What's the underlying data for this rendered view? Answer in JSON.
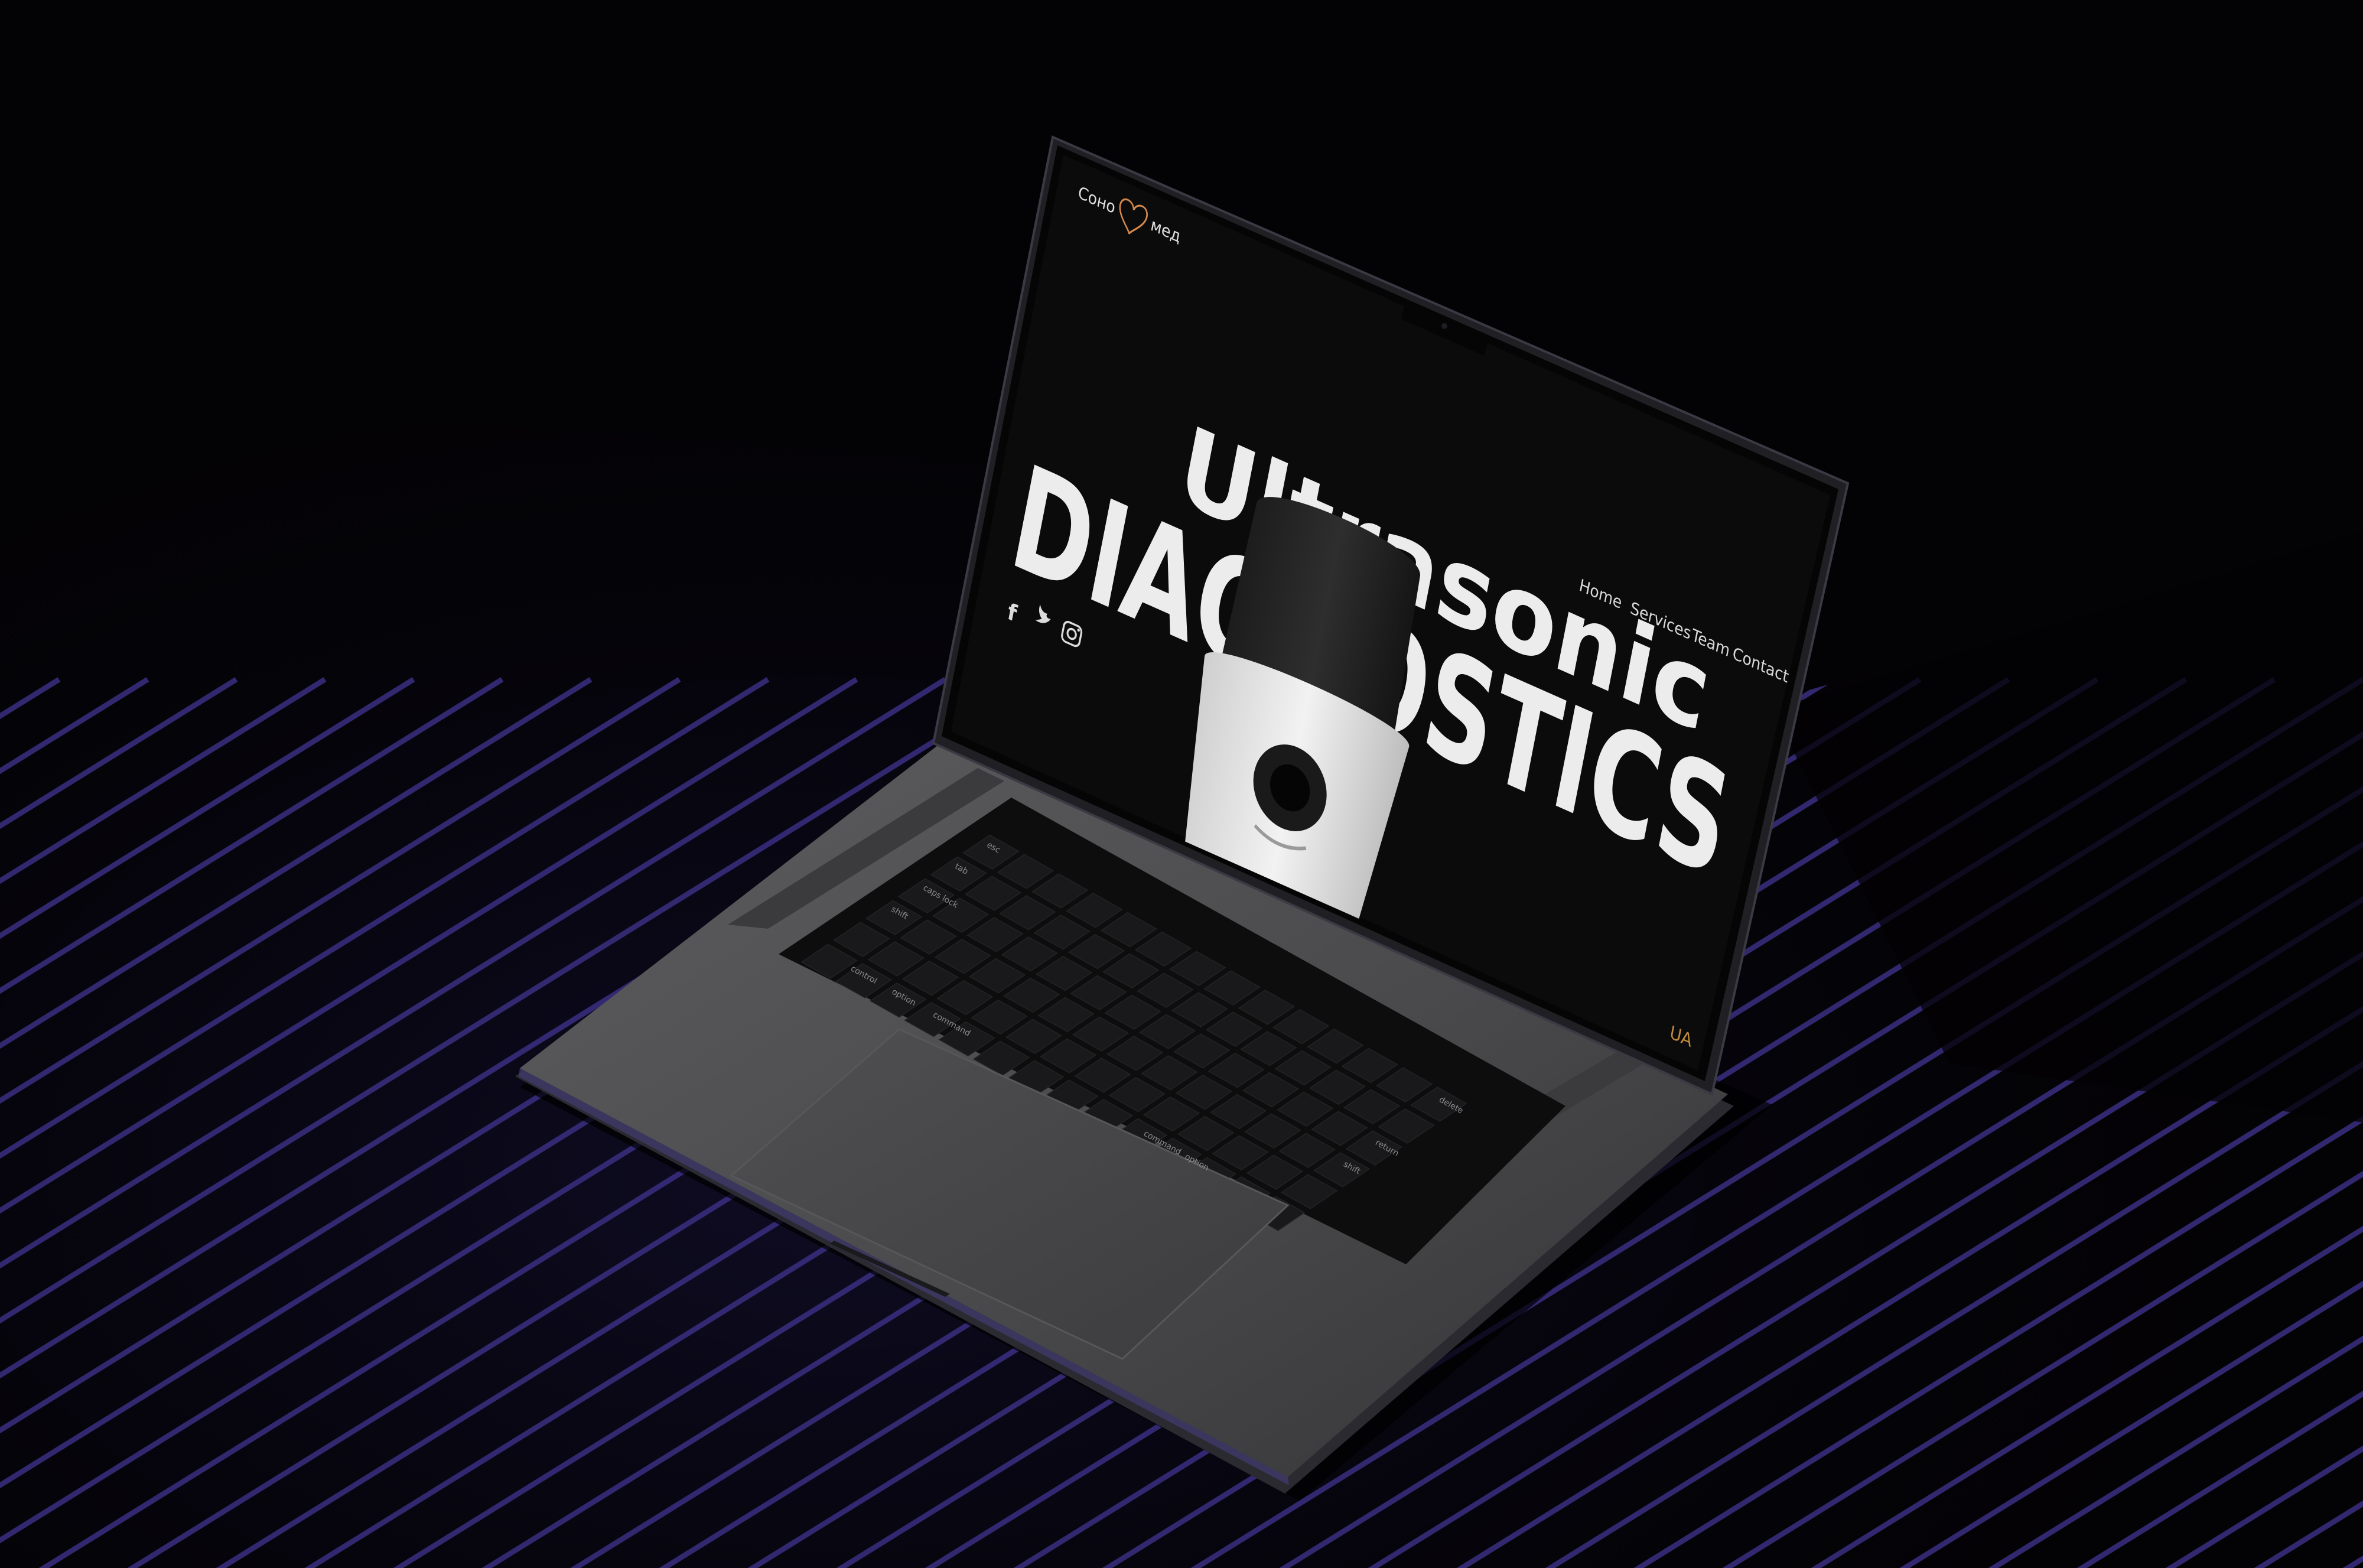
{
  "site": {
    "logo": {
      "word_left": "Сонo",
      "word_right": "мед",
      "mark": "heart-plus-icon",
      "accent_color": "#d4884c"
    },
    "nav": [
      {
        "label": "Home"
      },
      {
        "label": "Services"
      },
      {
        "label": "Team"
      },
      {
        "label": "Contact"
      }
    ],
    "hero": {
      "line1": "Ultrasonic",
      "line2": "DIAGNOSTICS"
    },
    "social": [
      {
        "icon": "facebook-icon"
      },
      {
        "icon": "twitter-icon"
      },
      {
        "icon": "instagram-icon"
      }
    ],
    "language": "UA"
  },
  "keyboard": {
    "keys": [
      "esc",
      "tab",
      "caps lock",
      "shift",
      "control",
      "option",
      "command",
      "command",
      "option",
      "delete",
      "return",
      "shift"
    ]
  },
  "colors": {
    "background": "#030204",
    "stripes": "#3a2f82",
    "screen": "#0b0b0c",
    "laptop_body": "#4c4c4e",
    "hero_text": "#ececec",
    "language_accent": "#c08a3e"
  }
}
